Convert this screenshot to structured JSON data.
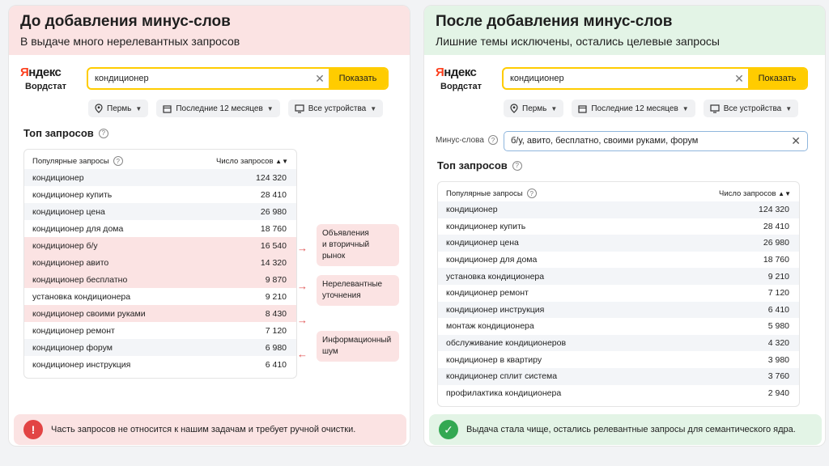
{
  "left": {
    "title": "До добавления минус-слов",
    "subtitle": "В выдаче много нерелевантных запросов",
    "logo": {
      "brand_first": "Я",
      "brand_rest": "ндекс",
      "product": "Вордстат"
    },
    "search": {
      "value": "кондиционер",
      "button": "Показать"
    },
    "filters": [
      "Пермь",
      "Последние 12 месяцев",
      "Все устройства"
    ],
    "section_title": "Топ запросов",
    "table_header": {
      "query": "Популярные запросы",
      "count": "Число запросов"
    },
    "rows": [
      {
        "q": "кондиционер",
        "n": "124 320"
      },
      {
        "q": "кондиционер купить",
        "n": "28 410"
      },
      {
        "q": "кондиционер цена",
        "n": "26 980"
      },
      {
        "q": "кондиционер для дома",
        "n": "18 760"
      },
      {
        "q": "кондиционер б/у",
        "n": "16 540"
      },
      {
        "q": "кондиционер авито",
        "n": "14 320"
      },
      {
        "q": "кондиционер бесплатно",
        "n": "9 870"
      },
      {
        "q": "установка кондиционера",
        "n": "9 210"
      },
      {
        "q": "кондиционер своими руками",
        "n": "8 430"
      },
      {
        "q": "кондиционер ремонт",
        "n": "7 120"
      },
      {
        "q": "кондиционер форум",
        "n": "6 980"
      },
      {
        "q": "кондиционер инструкция",
        "n": "6 410"
      }
    ],
    "notes": [
      {
        "line1": "Объявления",
        "line2": "и вторичный рынок"
      },
      {
        "line1": "Нерелевантные",
        "line2": "уточнения"
      },
      {
        "line1": "Информационный",
        "line2": "шум"
      }
    ],
    "footer": "Часть запросов не относится к нашим задачам и требует ручной очистки."
  },
  "right": {
    "title": "После добавления минус-слов",
    "subtitle": "Лишние темы исключены, остались целевые запросы",
    "logo": {
      "brand_first": "Я",
      "brand_rest": "ндекс",
      "product": "Вордстат"
    },
    "search": {
      "value": "кондиционер",
      "button": "Показать"
    },
    "filters": [
      "Пермь",
      "Последние 12 месяцев",
      "Все устройства"
    ],
    "minus_label": "Минус-слова",
    "minus_value": "б/у, авито, бесплатно, своими руками, форум",
    "section_title": "Топ запросов",
    "table_header": {
      "query": "Популярные запросы",
      "count": "Число запросов"
    },
    "rows": [
      {
        "q": "кондиционер",
        "n": "124 320"
      },
      {
        "q": "кондиционер купить",
        "n": "28 410"
      },
      {
        "q": "кондиционер цена",
        "n": "26 980"
      },
      {
        "q": "кондиционер для дома",
        "n": "18 760"
      },
      {
        "q": "установка кондиционера",
        "n": "9 210"
      },
      {
        "q": "кондиционер ремонт",
        "n": "7 120"
      },
      {
        "q": "кондиционер инструкция",
        "n": "6 410"
      },
      {
        "q": "монтаж кондиционера",
        "n": "5 980"
      },
      {
        "q": "обслуживание кондиционеров",
        "n": "4 320"
      },
      {
        "q": "кондиционер в квартиру",
        "n": "3 980"
      },
      {
        "q": "кондиционер сплит система",
        "n": "3 760"
      },
      {
        "q": "профилактика кондиционера",
        "n": "2 940"
      }
    ],
    "footer": "Выдача стала чище, остались релевантные запросы для семантического ядра."
  },
  "colors": {
    "accent": "#ffcc00",
    "bad": "#fbe3e3",
    "good": "#e3f4e6",
    "error": "#e24444",
    "success": "#33a852"
  }
}
